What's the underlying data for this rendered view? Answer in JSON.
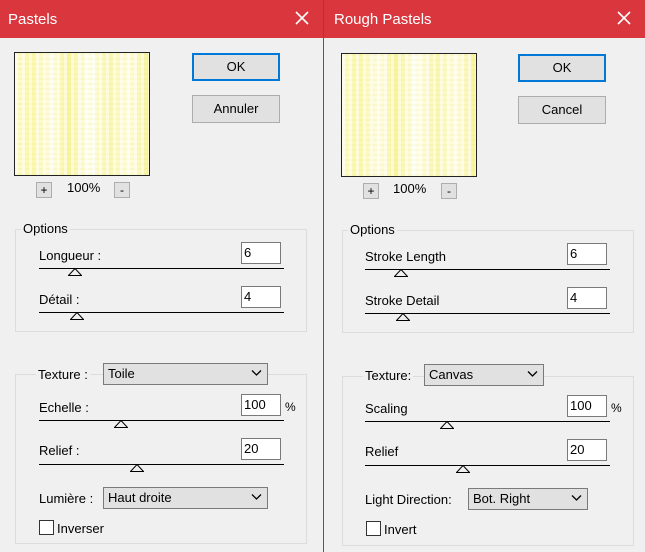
{
  "left": {
    "title": "Pastels",
    "ok_label": "OK",
    "cancel_label": "Annuler",
    "zoom_in": "+",
    "zoom_out": "-",
    "zoom_level": "100%",
    "options_label": "Options",
    "stroke_length_label": "Longueur :",
    "stroke_length_value": "6",
    "stroke_detail_label": "Détail :",
    "stroke_detail_value": "4",
    "texture_label": "Texture :",
    "texture_value": "Toile",
    "scaling_label": "Echelle :",
    "scaling_value": "100",
    "scaling_unit": "%",
    "relief_label": "Relief :",
    "relief_value": "20",
    "light_label": "Lumière :",
    "light_value": "Haut droite",
    "invert_label": "Inverser",
    "invert_checked": false
  },
  "right": {
    "title": "Rough Pastels",
    "ok_label": "OK",
    "cancel_label": "Cancel",
    "zoom_in": "+",
    "zoom_out": "-",
    "zoom_level": "100%",
    "options_label": "Options",
    "stroke_length_label": "Stroke Length",
    "stroke_length_value": "6",
    "stroke_detail_label": "Stroke Detail",
    "stroke_detail_value": "4",
    "texture_label": "Texture:",
    "texture_value": "Canvas",
    "scaling_label": "Scaling",
    "scaling_value": "100",
    "scaling_unit": "%",
    "relief_label": "Relief",
    "relief_value": "20",
    "light_label": "Light Direction:",
    "light_value": "Bot. Right",
    "invert_label": "Invert",
    "invert_checked": false
  },
  "colors": {
    "titlebar": "#d9363d",
    "default_button_border": "#0078d7",
    "preview_tint": "#f9f49a"
  },
  "icons": [
    "close-icon",
    "chevron-down-icon",
    "slider-thumb-icon"
  ]
}
